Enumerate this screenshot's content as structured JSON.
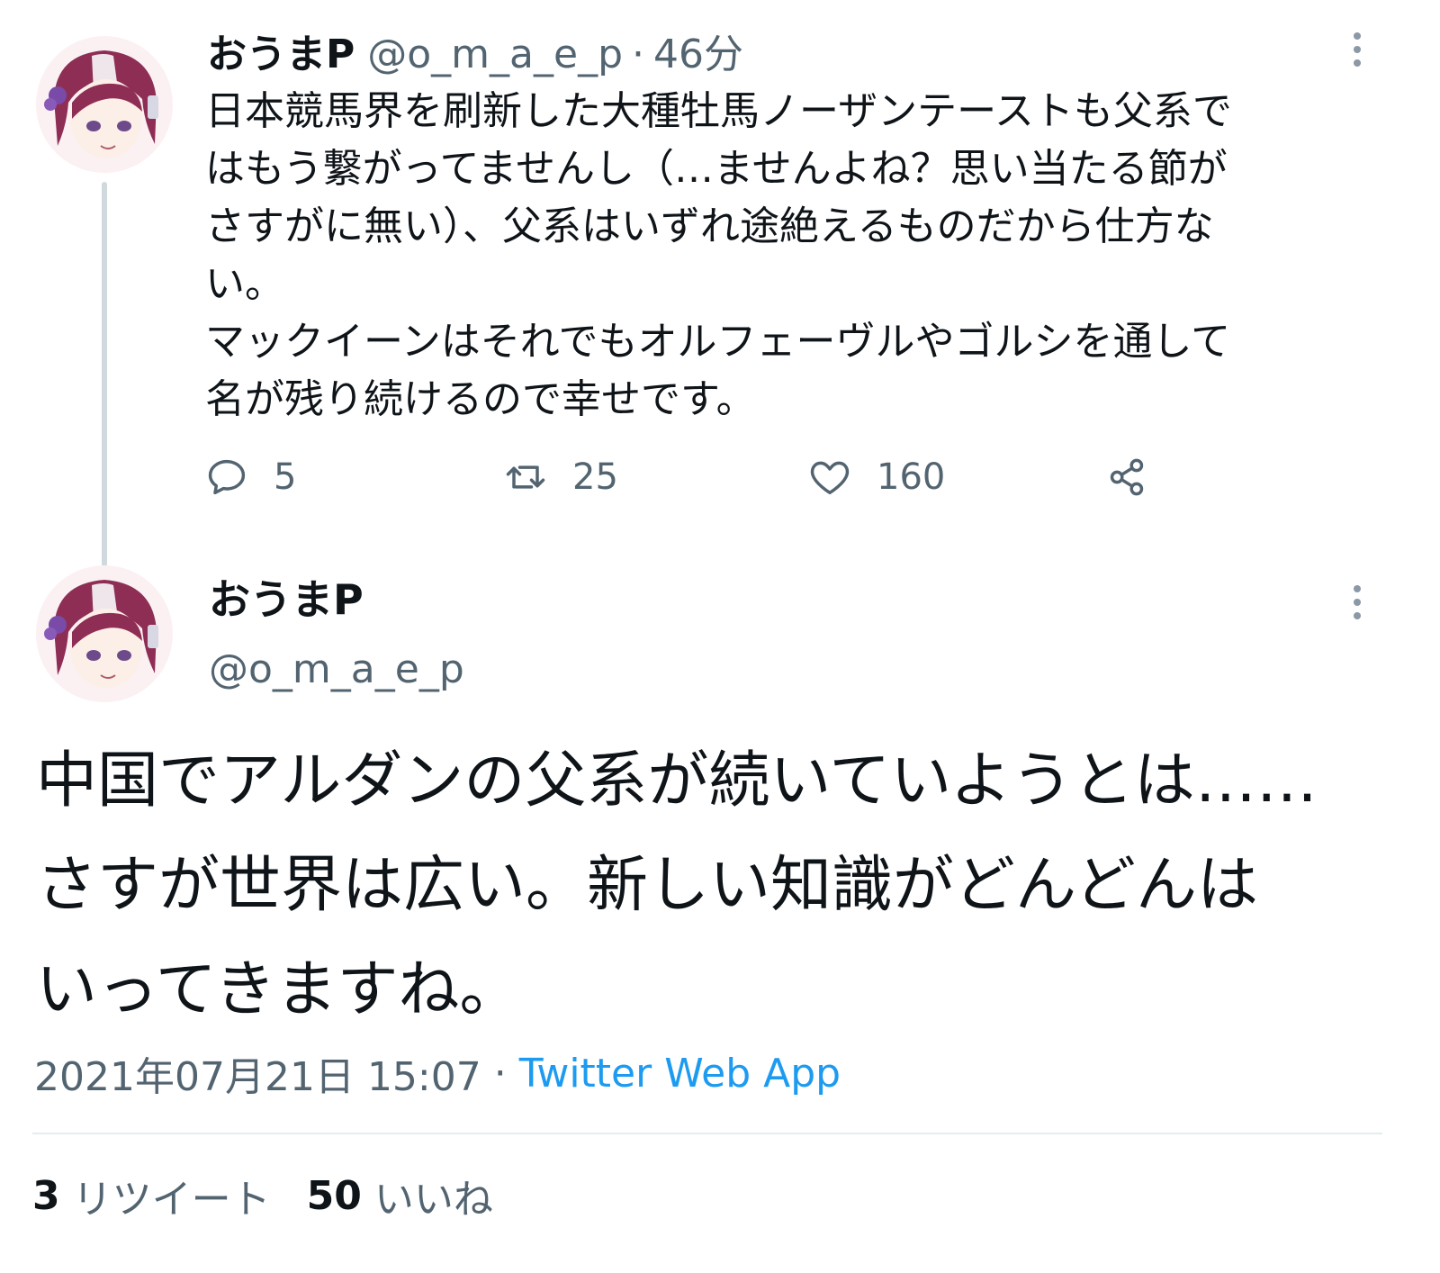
{
  "parent_tweet": {
    "display_name": "おうまP",
    "handle": "@o_m_a_e_p",
    "separator": "·",
    "relative_time": "46分",
    "text": "日本競馬界を刷新した大種牡馬ノーザンテーストも父系で\nはもう繋がってませんし（…ませんよね？思い当たる節が\nさすがに無い）、父系はいずれ途絶えるものだから仕方な\nい。\nマックイーンはそれでもオルフェーヴルやゴルシを通して\n名が残り続けるので幸せです。",
    "actions": {
      "reply_count": "5",
      "retweet_count": "25",
      "like_count": "160"
    },
    "icons": {
      "reply": "reply-icon",
      "retweet": "retweet-icon",
      "like": "heart-icon",
      "share": "share-icon",
      "more": "more-options-icon"
    }
  },
  "focused_tweet": {
    "display_name": "おうまP",
    "handle": "@o_m_a_e_p",
    "text": "中国でアルダンの父系が続いていようとは……\nさすが世界は広い。新しい知識がどんどんは\nいってきますね。",
    "timestamp": "2021年07月21日 15:07",
    "separator": "·",
    "source": "Twitter Web App",
    "retweet_count": "3",
    "retweet_label": "リツイート",
    "like_count": "50",
    "like_label": "いいね"
  },
  "colors": {
    "text_primary": "#0f1419",
    "text_secondary": "#536471",
    "link": "#1d9bf0",
    "thread_line": "#cfd9de",
    "divider": "#e6ecf0"
  }
}
